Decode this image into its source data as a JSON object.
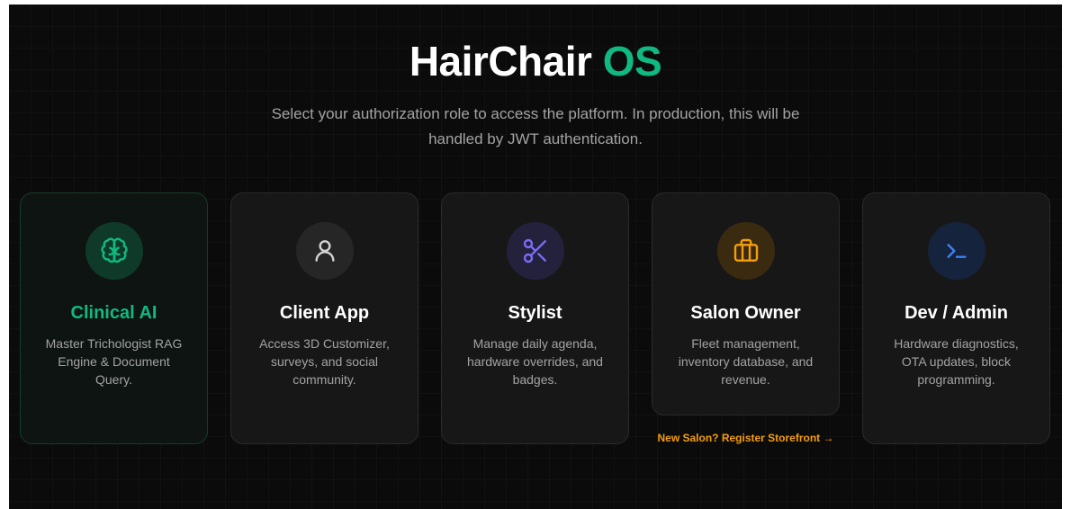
{
  "header": {
    "title_main": "HairChair",
    "title_accent": "OS",
    "subtitle": "Select your authorization role to access the platform. In production, this will be handled by JWT authentication."
  },
  "roles": [
    {
      "title": "Clinical AI",
      "description": "Master Trichologist RAG Engine & Document Query.",
      "icon": "brain-icon",
      "accent": "#10b981"
    },
    {
      "title": "Client App",
      "description": "Access 3D Customizer, surveys, and social community.",
      "icon": "user-icon",
      "accent": "#d4d4d4"
    },
    {
      "title": "Stylist",
      "description": "Manage daily agenda, hardware overrides, and badges.",
      "icon": "scissors-icon",
      "accent": "#7c6cf5"
    },
    {
      "title": "Salon Owner",
      "description": "Fleet management, inventory database, and revenue.",
      "icon": "briefcase-icon",
      "accent": "#f59e0b"
    },
    {
      "title": "Dev / Admin",
      "description": "Hardware diagnostics, OTA updates, block programming.",
      "icon": "terminal-icon",
      "accent": "#3b82f6"
    }
  ],
  "register_link": "New Salon? Register Storefront →"
}
